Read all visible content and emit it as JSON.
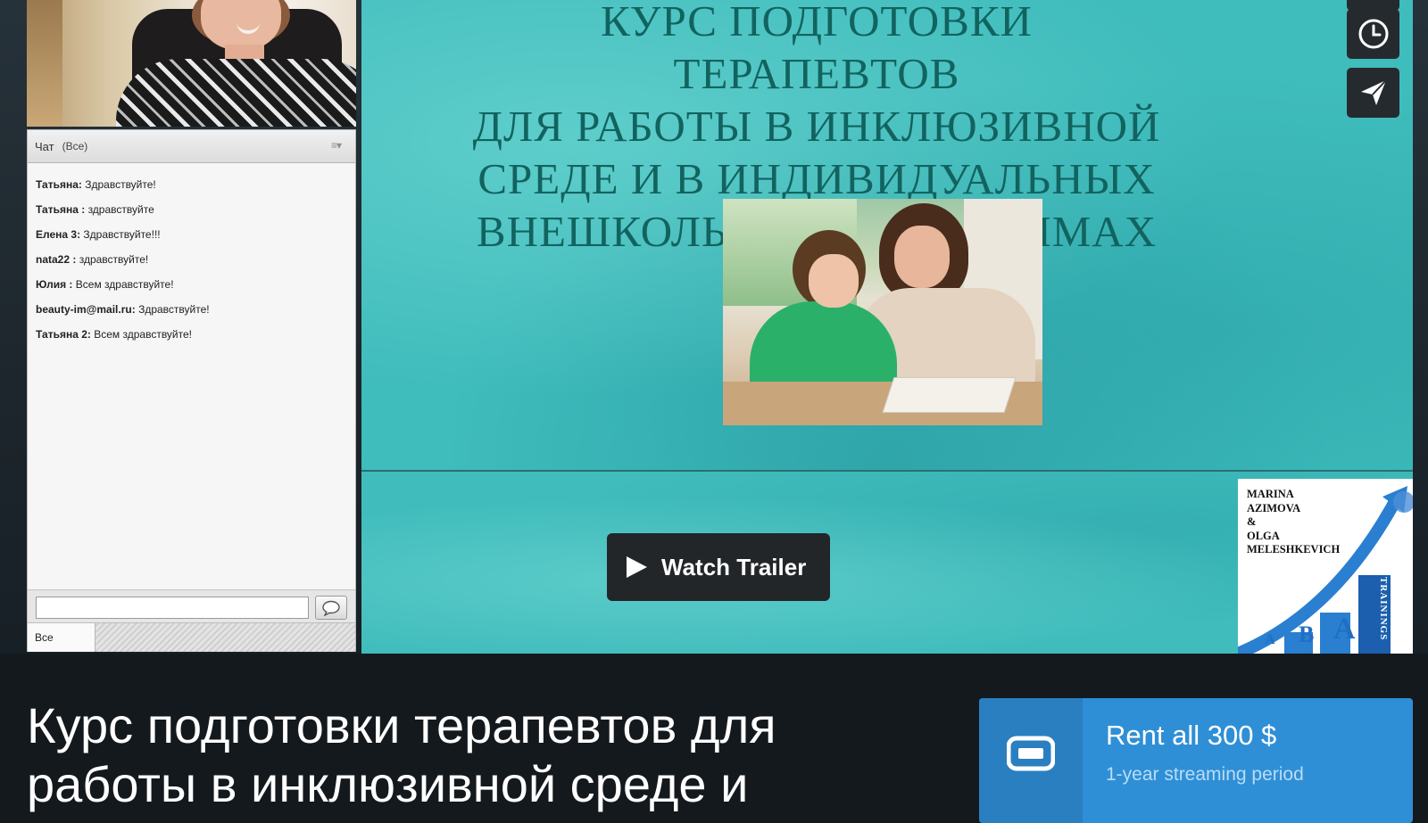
{
  "chat": {
    "title": "Чат",
    "scope": "(Все)",
    "menu_glyph": "≡▾",
    "messages": [
      {
        "author": "Татьяна",
        "text": "Здравствуйте!"
      },
      {
        "author": "Татьяна ",
        "text": "здравствуйте"
      },
      {
        "author": "Елена 3",
        "text": "Здравствуйте!!!"
      },
      {
        "author": "nata22 ",
        "text": "здравствуйте!"
      },
      {
        "author": "Юлия ",
        "text": "Всем здравствуйте!"
      },
      {
        "author": "beauty-im@mail.ru",
        "text": "Здравствуйте!"
      },
      {
        "author": "Татьяна 2",
        "text": "Всем здравствуйте!"
      }
    ],
    "input_value": "",
    "tab_label": "Все"
  },
  "slide": {
    "title_lines": [
      "КУРС ПОДГОТОВКИ ТЕРАПЕВТОВ",
      "ДЛЯ РАБОТЫ В ИНКЛЮЗИВНОЙ",
      "СРЕДЕ И В ИНДИВИДУАЛЬНЫХ",
      "ВНЕШКОЛЬНЫХ ПРОГРАММАХ"
    ]
  },
  "tools": [
    {
      "icon": "clock-icon"
    },
    {
      "icon": "send-icon"
    }
  ],
  "player": {
    "watch_trailer_label": "Watch Trailer"
  },
  "logo": {
    "names": "MARINA\nAZIMOVA\n&\nOLGA\nMELESHKEVICH",
    "letters": [
      "A",
      "B",
      "A"
    ],
    "vertical_text": "TRAININGS"
  },
  "course": {
    "title": "Курс подготовки терапевтов для работы в инклюзивной среде и"
  },
  "rent": {
    "title": "Rent all 300 $",
    "subtitle": "1-year streaming period",
    "icon": "ticket-icon"
  },
  "colors": {
    "slide_teal": "#3fbcbc",
    "title_teal": "#12635f",
    "rent_blue": "#2f8fd6",
    "page_dark": "#14191d"
  }
}
